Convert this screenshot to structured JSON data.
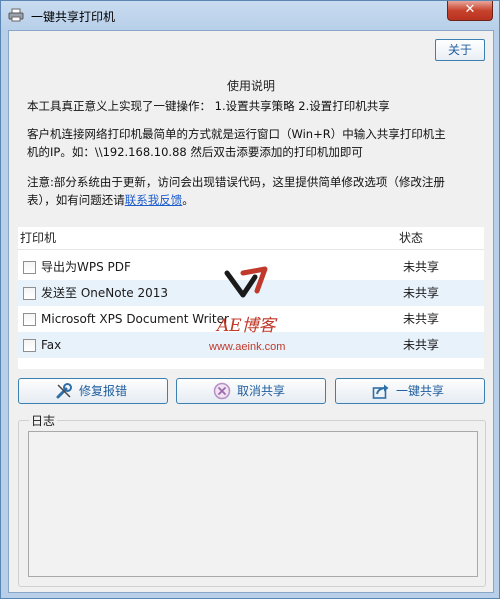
{
  "window": {
    "title": "一键共享打印机",
    "close_label": "✕"
  },
  "toolbar": {
    "about_label": "关于"
  },
  "instructions": {
    "title": "使用说明",
    "para1": "本工具真正意义上实现了一键操作：  1.设置共享策略  2.设置打印机共享",
    "para2_line1": "客户机连接网络打印机最简单的方式就是运行窗口（Win+R）中输入共享打印机主",
    "para2_line2": "机的IP。如：\\\\192.168.10.88 然后双击添要添加的打印机加即可",
    "para3_line1": "注意:部分系统由于更新，访问会出现错误代码，这里提供简单修改选项（修改注册",
    "para3_line2_prefix": "表），如有问题还请",
    "para3_link": "联系我反馈",
    "para3_suffix": "。"
  },
  "printers": {
    "col_printer": "打印机",
    "col_status": "状态",
    "rows": [
      {
        "name": "导出为WPS PDF",
        "status": "未共享"
      },
      {
        "name": "发送至 OneNote 2013",
        "status": "未共享"
      },
      {
        "name": "Microsoft XPS Document Writer",
        "status": "未共享"
      },
      {
        "name": "Fax",
        "status": "未共享"
      }
    ]
  },
  "watermark": {
    "brand": "AE博客",
    "url": "www.aeink.com"
  },
  "actions": {
    "repair_label": "修复报错",
    "cancel_label": "取消共享",
    "share_label": "一键共享"
  },
  "log": {
    "label": "日志"
  },
  "colors": {
    "accent": "#1f5e9e",
    "row_alt": "#e8f2fb",
    "watermark_red": "#c0392b"
  },
  "icons": [
    "printer-icon",
    "wrench-icon",
    "cancel-circle-icon",
    "share-icon"
  ]
}
